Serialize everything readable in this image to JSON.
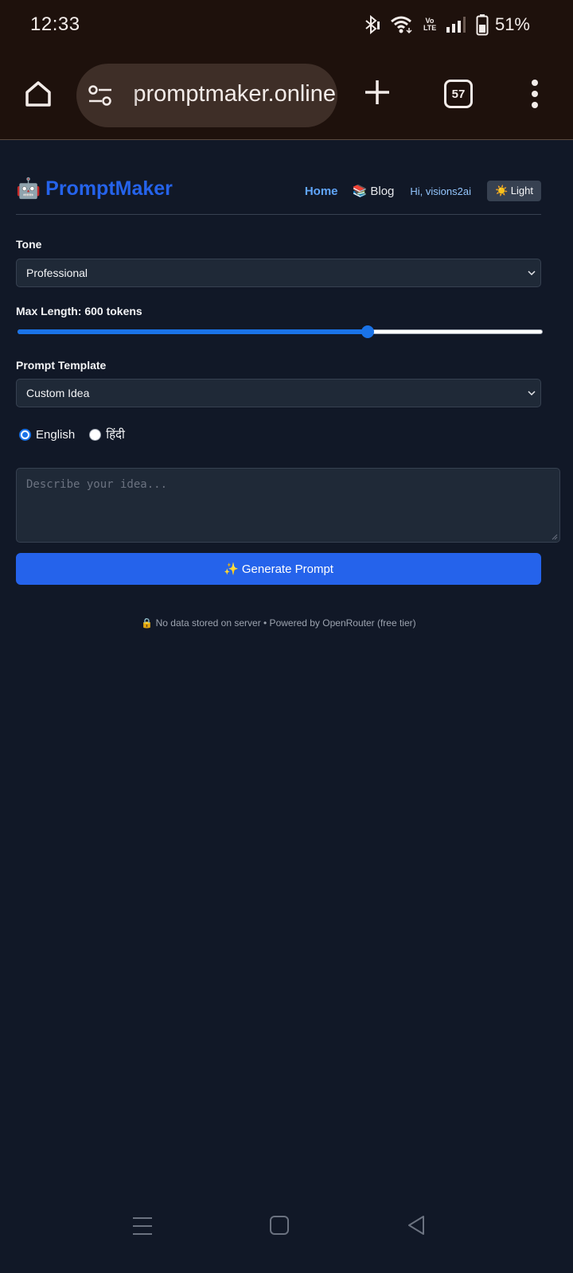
{
  "status_bar": {
    "time": "12:33",
    "volte": "Vo\nLTE",
    "battery_pct": "51%",
    "battery_level": 0.51,
    "icons": [
      "bluetooth-icon",
      "wifi-icon",
      "volte-icon",
      "signal-icon",
      "battery-icon"
    ]
  },
  "browser": {
    "url": "promptmaker.online",
    "tab_count": "57",
    "icons": [
      "home-icon",
      "site-settings-icon",
      "new-tab-icon",
      "tabs-icon",
      "menu-icon"
    ]
  },
  "site": {
    "brand_emoji": "🤖",
    "brand_name": "PromptMaker",
    "nav": {
      "home": "Home",
      "blog": "📚 Blog",
      "user": "Hi, visions2ai",
      "theme_toggle": "☀️ Light"
    }
  },
  "form": {
    "tone_label": "Tone",
    "tone_value": "Professional",
    "max_length_label": "Max Length: 600 tokens",
    "max_length_fraction": 0.667,
    "template_label": "Prompt Template",
    "template_value": "Custom Idea",
    "languages": [
      {
        "label": "English",
        "checked": true
      },
      {
        "label": "हिंदी",
        "checked": false
      }
    ],
    "idea_placeholder": "Describe your idea...",
    "generate_button": "✨ Generate Prompt"
  },
  "footer": {
    "note": "🔒 No data stored on server • Powered by OpenRouter (free tier)"
  },
  "colors": {
    "page_bg": "#111827",
    "accent": "#2563eb",
    "browser_bg": "#1e110c"
  },
  "system_nav": [
    "recents-icon",
    "home-button-icon",
    "back-icon"
  ]
}
